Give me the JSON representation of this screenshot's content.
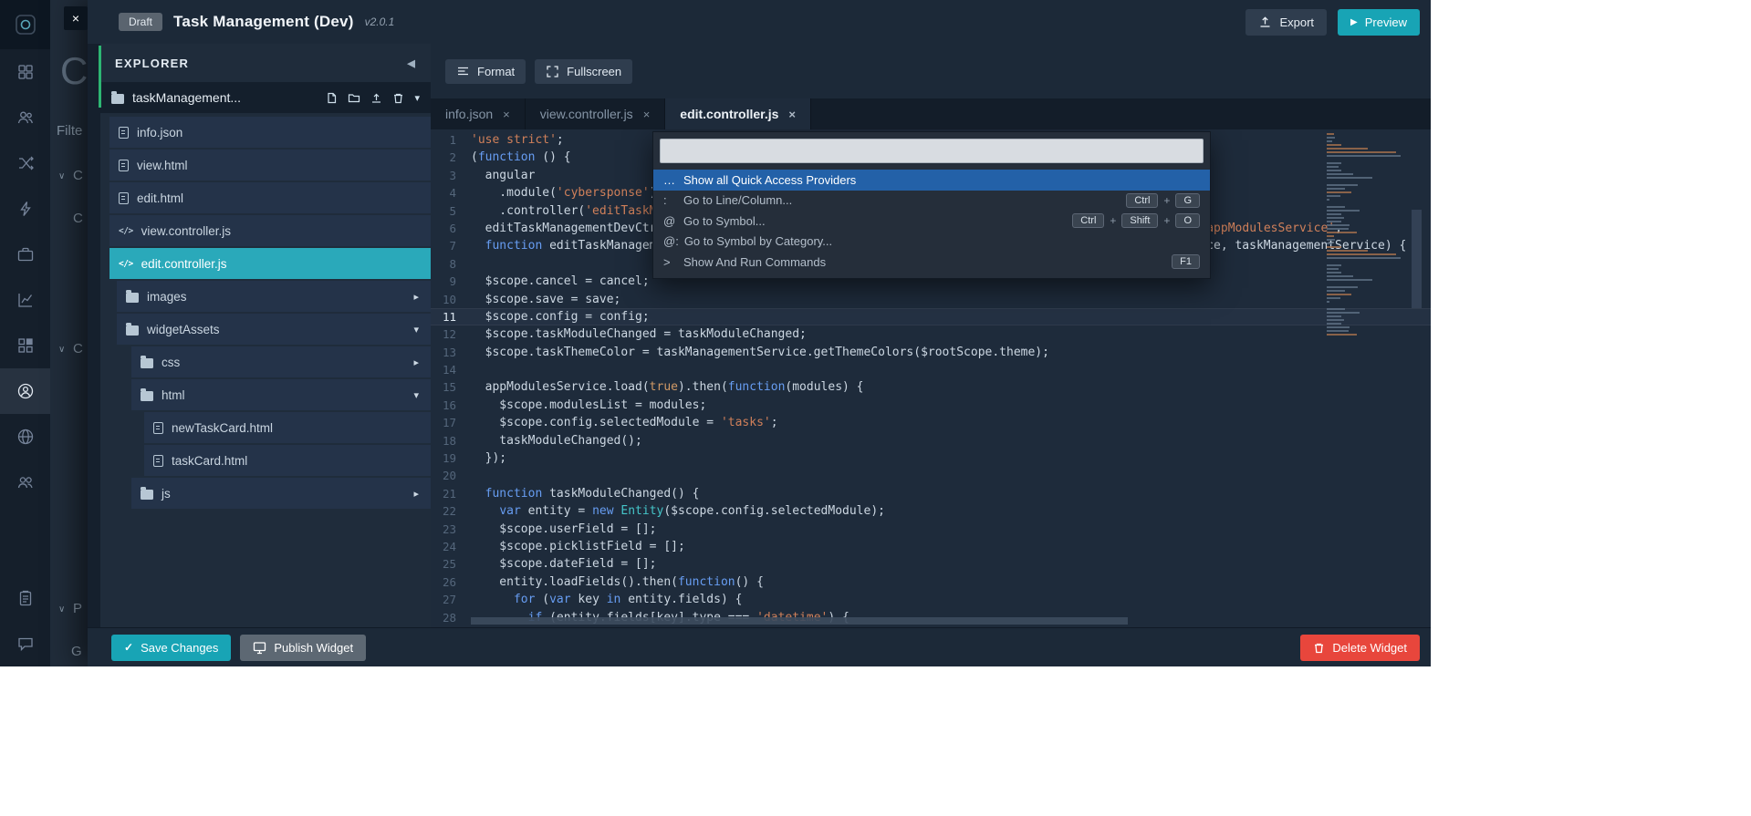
{
  "header": {
    "badge": "Draft",
    "title": "Task Management (Dev)",
    "version": "v2.0.1",
    "export_label": "Export",
    "preview_label": "Preview"
  },
  "explorer": {
    "title": "EXPLORER",
    "root_name": "taskManagement...",
    "tree": [
      {
        "label": "info.json",
        "icon": "file",
        "inset": 10
      },
      {
        "label": "view.html",
        "icon": "file",
        "inset": 10
      },
      {
        "label": "edit.html",
        "icon": "file",
        "inset": 10
      },
      {
        "label": "view.controller.js",
        "icon": "code",
        "inset": 10
      },
      {
        "label": "edit.controller.js",
        "icon": "code",
        "inset": 10,
        "selected": true
      },
      {
        "label": "images",
        "icon": "folder",
        "inset": 18,
        "chevron": "right"
      },
      {
        "label": "widgetAssets",
        "icon": "folder",
        "inset": 18,
        "chevron": "down"
      },
      {
        "label": "css",
        "icon": "folder",
        "inset": 34,
        "chevron": "right"
      },
      {
        "label": "html",
        "icon": "folder",
        "inset": 34,
        "chevron": "down"
      },
      {
        "label": "newTaskCard.html",
        "icon": "file",
        "inset": 48
      },
      {
        "label": "taskCard.html",
        "icon": "file",
        "inset": 48
      },
      {
        "label": "js",
        "icon": "folder",
        "inset": 34,
        "chevron": "right"
      }
    ]
  },
  "editor": {
    "toolbar": {
      "format_label": "Format",
      "fullscreen_label": "Fullscreen"
    },
    "tabs": [
      {
        "label": "info.json"
      },
      {
        "label": "view.controller.js"
      },
      {
        "label": "edit.controller.js",
        "active": true
      }
    ],
    "active_line": 11,
    "code_lines": [
      "'use strict';",
      "(function () {",
      "  angular",
      "    .module('cybersponse')",
      "    .controller('editTaskManagementDevCtrl', editTaskManagementDevCtrl);",
      "  editTaskManagementDevCtrl.$inject = ['$scope', '$rootScope', '$timeout', '$filter', '$state', '$q', 'appModulesService',",
      "  function editTaskManagementDevCtrl($scope, $rootScope, $timeout, $filter, $state, $q, appModulesService, taskManagementService) {",
      "",
      "  $scope.cancel = cancel;",
      "  $scope.save = save;",
      "  $scope.config = config;",
      "  $scope.taskModuleChanged = taskModuleChanged;",
      "  $scope.taskThemeColor = taskManagementService.getThemeColors($rootScope.theme);",
      "",
      "  appModulesService.load(true).then(function(modules) {",
      "    $scope.modulesList = modules;",
      "    $scope.config.selectedModule = 'tasks';",
      "    taskModuleChanged();",
      "  });",
      "",
      "  function taskModuleChanged() {",
      "    var entity = new Entity($scope.config.selectedModule);",
      "    $scope.userField = [];",
      "    $scope.picklistField = [];",
      "    $scope.dateField = [];",
      "    entity.loadFields().then(function() {",
      "      for (var key in entity.fields) {",
      "        if (entity.fields[key].type === 'datetime') {"
    ]
  },
  "quick_access": {
    "input_value": "",
    "rows": [
      {
        "prefix": "…",
        "label": "Show all Quick Access Providers",
        "keys": [],
        "selected": true
      },
      {
        "prefix": ":",
        "label": "Go to Line/Column...",
        "keys": [
          "Ctrl",
          "G"
        ]
      },
      {
        "prefix": "@",
        "label": "Go to Symbol...",
        "keys": [
          "Ctrl",
          "Shift",
          "O"
        ]
      },
      {
        "prefix": "@:",
        "label": "Go to Symbol by Category...",
        "keys": []
      },
      {
        "prefix": ">",
        "label": "Show And Run Commands",
        "keys": [
          "F1"
        ]
      }
    ]
  },
  "footer": {
    "save_label": "Save Changes",
    "publish_label": "Publish Widget",
    "delete_label": "Delete Widget"
  },
  "background_page": {
    "heading": "C",
    "filter_label": "Filte",
    "item1": "C",
    "item2": "C",
    "item3": "C",
    "item4": "P",
    "item5": "G"
  },
  "icons": {
    "close": "×",
    "tab_close": "×",
    "collapse_left": "◀",
    "chevron_down": "▾",
    "chevron_right": "▸",
    "section_chevron": "∨",
    "play": "▶",
    "check": "✓"
  },
  "rail_icon_names": [
    "app-logo",
    "grid",
    "users",
    "flows",
    "automation",
    "cases",
    "reports",
    "widgets",
    "profile",
    "globe",
    "people",
    "tasks",
    "chat"
  ],
  "colors": {
    "accent_teal": "#18a4b5",
    "danger_red": "#e8463c",
    "selection_blue": "#2361a8",
    "string_orange": "#d0805a",
    "keyword_blue": "#679df2",
    "class_teal": "#45c5c9",
    "selected_file_teal": "#2aa9ba"
  }
}
